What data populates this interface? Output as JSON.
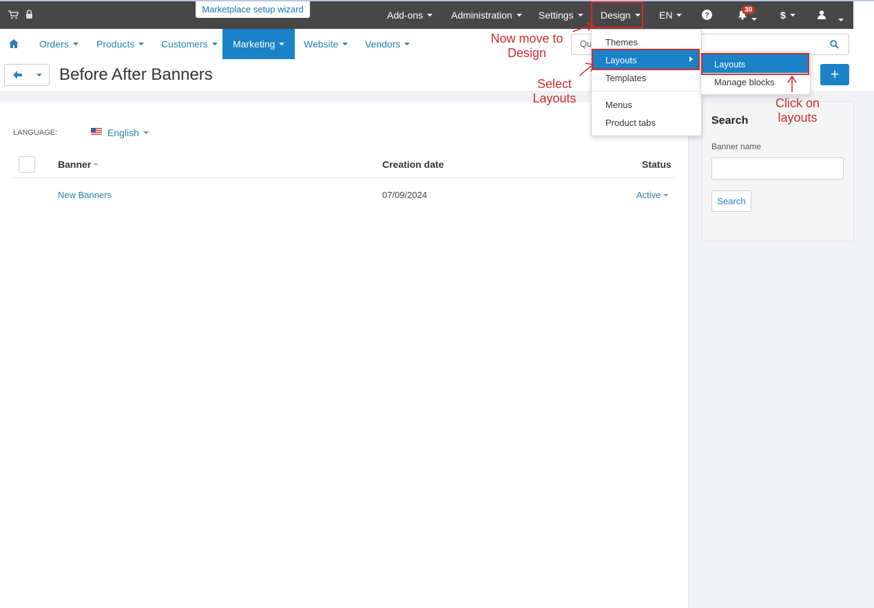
{
  "topbar": {
    "wizard_label": "Marketplace setup wizard",
    "addons": "Add-ons",
    "administration": "Administration",
    "settings": "Settings",
    "design": "Design",
    "language": "EN",
    "notifications_count": "30",
    "currency": "$"
  },
  "nav": {
    "orders": "Orders",
    "products": "Products",
    "customers": "Customers",
    "marketing": "Marketing",
    "website": "Website",
    "vendors": "Vendors",
    "quick_search_text": "Qu"
  },
  "page": {
    "title": "Before After Banners",
    "language_label": "LANGUAGE:",
    "language_value": "English"
  },
  "table": {
    "columns": {
      "banner": "Banner",
      "creation_date": "Creation date",
      "status": "Status"
    },
    "rows": [
      {
        "banner": "New Banners",
        "creation_date": "07/09/2024",
        "status": "Active"
      }
    ]
  },
  "sidebar": {
    "title": "Search",
    "banner_name_label": "Banner name",
    "search_button": "Search"
  },
  "design_menu": {
    "items": [
      "Themes",
      "Layouts",
      "Templates",
      "Menus",
      "Product tabs"
    ],
    "submenu": [
      "Layouts",
      "Manage blocks"
    ]
  },
  "annotations": {
    "step1": [
      "Now move to",
      "Design"
    ],
    "step2": [
      "Select",
      "Layouts"
    ],
    "step3": [
      "Click on",
      "layouts"
    ]
  },
  "colors": {
    "topbar": "#474747",
    "accent": "#1a82c6",
    "link": "#2980b9",
    "annotation": "#d42b2b"
  }
}
